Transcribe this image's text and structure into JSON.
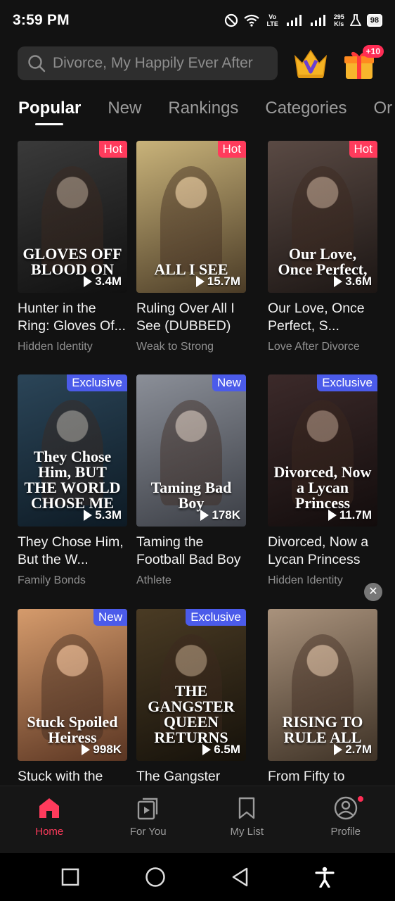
{
  "status_bar": {
    "time": "3:59 PM",
    "net_speed_top": "295",
    "net_speed_bottom": "K/s",
    "battery": "98",
    "lte": "Vo LTE"
  },
  "search": {
    "placeholder": "Divorce, My Happily Ever After"
  },
  "header": {
    "gift_badge": "+10"
  },
  "tabs": [
    {
      "label": "Popular",
      "active": true
    },
    {
      "label": "New"
    },
    {
      "label": "Rankings"
    },
    {
      "label": "Categories"
    },
    {
      "label": "Or"
    }
  ],
  "cards": [
    {
      "title": "Hunter in the Ring: Gloves Of...",
      "genre": "Hidden Identity",
      "plays": "3.4M",
      "tag": "Hot",
      "tag_type": "hot",
      "poster_text": "GLOVES OFF BLOOD ON",
      "colors": [
        "#3a3a3a",
        "#101010"
      ]
    },
    {
      "title": "Ruling Over All I See (DUBBED)",
      "genre": "Weak to Strong",
      "plays": "15.7M",
      "tag": "Hot",
      "tag_type": "hot",
      "poster_text": "ALL I SEE",
      "colors": [
        "#c9b37a",
        "#4a3b26"
      ]
    },
    {
      "title": "Our Love, Once Perfect, S...",
      "genre": "Love After Divorce",
      "plays": "3.6M",
      "tag": "Hot",
      "tag_type": "hot",
      "poster_text": "Our Love, Once Perfect,",
      "colors": [
        "#5a4a44",
        "#1c1614"
      ]
    },
    {
      "title": "They Chose Him, But the W...",
      "genre": "Family Bonds",
      "plays": "5.3M",
      "tag": "Exclusive",
      "tag_type": "exclusive",
      "poster_text": "They Chose Him, BUT THE WORLD CHOSE ME",
      "colors": [
        "#2b4558",
        "#0d1a24"
      ]
    },
    {
      "title": "Taming the Football Bad Boy",
      "genre": "Athlete",
      "plays": "178K",
      "tag": "New",
      "tag_type": "new",
      "poster_text": "Taming Bad Boy",
      "colors": [
        "#8b8f98",
        "#3b3e45"
      ]
    },
    {
      "title": "Divorced, Now a Lycan Princess",
      "genre": "Hidden Identity",
      "plays": "11.7M",
      "tag": "Exclusive",
      "tag_type": "exclusive",
      "poster_text": "Divorced, Now a Lycan Princess",
      "colors": [
        "#3c2a2a",
        "#120c0c"
      ]
    },
    {
      "title": "Stuck with the Spoiled Heiress",
      "genre": "",
      "plays": "998K",
      "tag": "New",
      "tag_type": "new",
      "poster_text": "Stuck Spoiled Heiress",
      "colors": [
        "#d59b6c",
        "#5a3522"
      ]
    },
    {
      "title": "The Gangster Queen Returns",
      "genre": "",
      "plays": "6.5M",
      "tag": "Exclusive",
      "tag_type": "exclusive",
      "poster_text": "THE GANGSTER QUEEN RETURNS",
      "colors": [
        "#4a3b24",
        "#15110a"
      ]
    },
    {
      "title": "From Fifty to Fearless",
      "genre": "",
      "plays": "2.7M",
      "tag": "",
      "tag_type": "",
      "poster_text": "RISING TO RULE ALL",
      "colors": [
        "#a9927c",
        "#3e3226"
      ]
    }
  ],
  "bottom_nav": [
    {
      "label": "Home",
      "icon": "home-icon",
      "active": true
    },
    {
      "label": "For You",
      "icon": "play-cards-icon"
    },
    {
      "label": "My List",
      "icon": "bookmark-icon"
    },
    {
      "label": "Profile",
      "icon": "profile-icon"
    }
  ],
  "colors": {
    "accent": "#ff3b5c",
    "tag_blue": "#4b5bea",
    "background": "#121212"
  }
}
